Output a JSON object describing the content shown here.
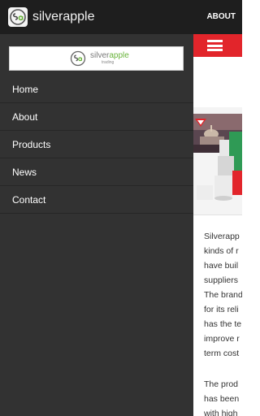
{
  "app": {
    "title": "silverapple",
    "about_label": "ABOUT",
    "icon": "sa-logo-icon"
  },
  "drawer": {
    "logo": {
      "name_prefix": "silver",
      "name_accent": "apple",
      "subtitle": "trading",
      "accent_color": "#68b33a"
    },
    "menu": [
      {
        "label": "Home"
      },
      {
        "label": "About"
      },
      {
        "label": "Products"
      },
      {
        "label": "News"
      },
      {
        "label": "Contact"
      }
    ]
  },
  "page": {
    "header_color": "#e2252b",
    "menu_icon": "hamburger-menu-icon",
    "paragraph1_lines": [
      "Silverapp",
      "kinds of r",
      "have buil",
      "suppliers",
      "The brand",
      "for its reli",
      "has the te",
      "improve r",
      "term cost"
    ],
    "paragraph2_lines": [
      "The prod",
      "has been",
      "with high"
    ]
  }
}
